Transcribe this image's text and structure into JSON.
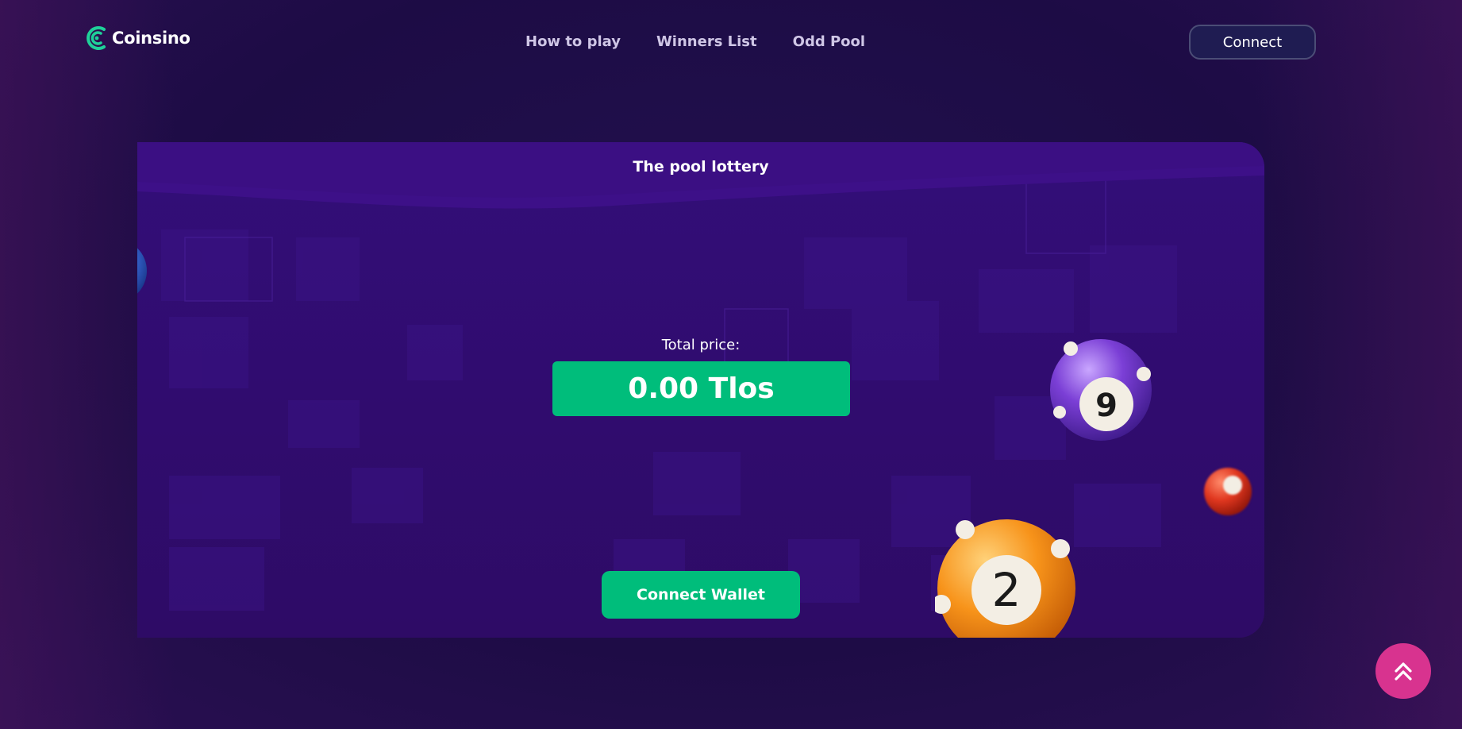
{
  "app": {
    "brand": "Coinsino"
  },
  "nav": {
    "items": [
      {
        "label": "How to play"
      },
      {
        "label": "Winners List"
      },
      {
        "label": "Odd Pool"
      }
    ],
    "connect_label": "Connect"
  },
  "lottery": {
    "title": "The pool lottery",
    "price_label": "Total price:",
    "price_value": "0.00 Tlos",
    "wallet_button": "Connect Wallet",
    "balls": [
      {
        "number": "9",
        "color": "#7b3fd6"
      },
      {
        "number": "2",
        "color": "#f7931a"
      },
      {
        "number": "",
        "color": "#e0371f"
      },
      {
        "number": "",
        "color": "#3a6bd8"
      }
    ]
  },
  "colors": {
    "accent": "#00bd7b",
    "scroll_top": "#d8338f",
    "background": "#1d0c45"
  },
  "icons": {
    "logo": "coinsino-logo-icon",
    "scroll_top": "double-chevron-up-icon"
  }
}
